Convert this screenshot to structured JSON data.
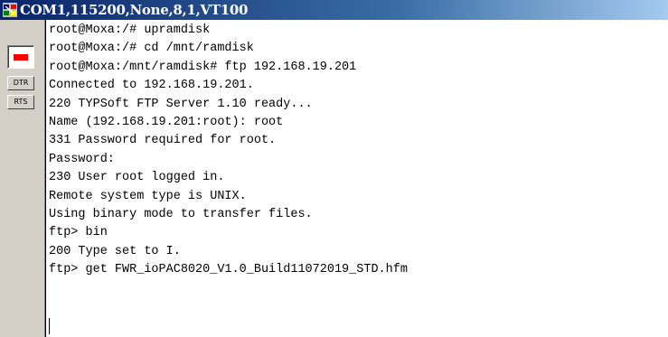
{
  "window": {
    "title": "COM1,115200,None,8,1,VT100",
    "title_icon": "terminal-app-icon"
  },
  "sidebar": {
    "led_icon": "red-led-icon",
    "led_color": "#ff0000",
    "dtr_label": "DTR",
    "rts_label": "RTS"
  },
  "terminal": {
    "lines": [
      "root@Moxa:/# upramdisk",
      "root@Moxa:/# cd /mnt/ramdisk",
      "root@Moxa:/mnt/ramdisk# ftp 192.168.19.201",
      "Connected to 192.168.19.201.",
      "220 TYPSoft FTP Server 1.10 ready...",
      "Name (192.168.19.201:root): root",
      "331 Password required for root.",
      "Password:",
      "230 User root logged in.",
      "Remote system type is UNIX.",
      "Using binary mode to transfer files.",
      "ftp> bin",
      "200 Type set to I.",
      "ftp> get FWR_ioPAC8020_V1.0_Build11072019_STD.hfm"
    ]
  }
}
